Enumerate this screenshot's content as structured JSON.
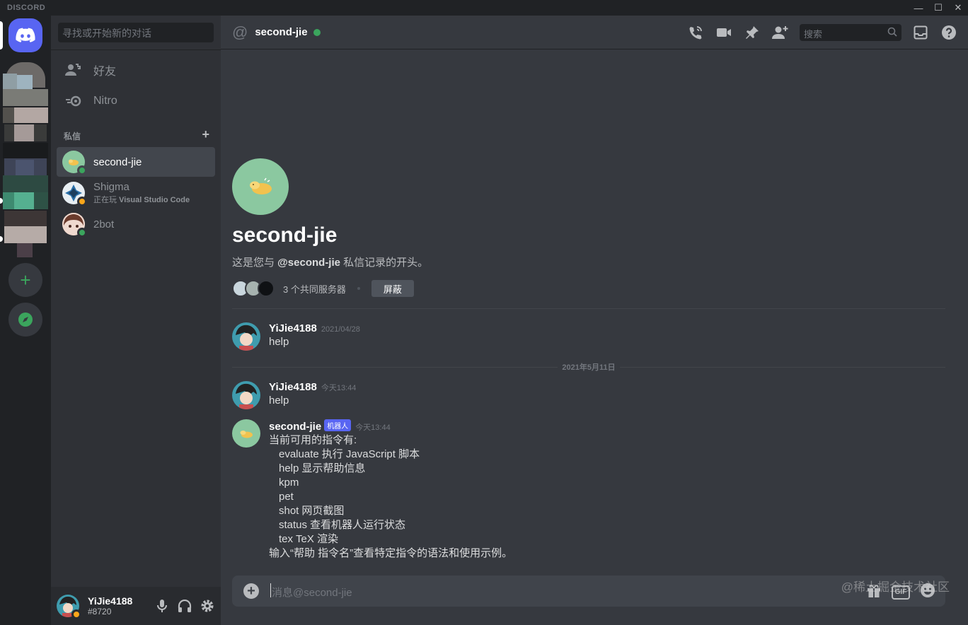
{
  "window": {
    "brand": "DISCORD"
  },
  "sidebar": {
    "search_placeholder": "寻找或开始新的对话",
    "nav": [
      {
        "label": "好友",
        "icon": "friends-icon"
      },
      {
        "label": "Nitro",
        "icon": "nitro-icon"
      }
    ],
    "dm_header": "私信",
    "dms": [
      {
        "name": "second-jie",
        "status": "online",
        "active": true
      },
      {
        "name": "Shigma",
        "activity_prefix": "正在玩",
        "activity_game": "Visual Studio Code",
        "status": "idle"
      },
      {
        "name": "2bot",
        "status": "online"
      }
    ]
  },
  "user": {
    "name": "YiJie4188",
    "tag": "#8720"
  },
  "header": {
    "title": "second-jie",
    "search_placeholder": "搜索"
  },
  "intro": {
    "title": "second-jie",
    "desc_prefix": "这是您与 ",
    "desc_mention": "@second-jie",
    "desc_suffix": " 私信记录的开头。",
    "mutual_servers": "3 个共同服务器",
    "block_label": "屏蔽"
  },
  "date_divider": "2021年5月11日",
  "messages": [
    {
      "author": "YiJie4188",
      "time": "2021/04/28",
      "text": "help"
    },
    {
      "author": "YiJie4188",
      "time": "今天13:44",
      "text": "help"
    },
    {
      "author": "second-jie",
      "bot_tag": "机器人",
      "time": "今天13:44",
      "intro_line": "当前可用的指令有:",
      "commands": [
        {
          "name": "evaluate",
          "desc": "执行 JavaScript 脚本"
        },
        {
          "name": "help",
          "desc": "显示帮助信息"
        },
        {
          "name": "kpm",
          "desc": ""
        },
        {
          "name": "pet",
          "desc": ""
        },
        {
          "name": "shot",
          "desc": "网页截图"
        },
        {
          "name": "status",
          "desc": "查看机器人运行状态"
        },
        {
          "name": "tex",
          "desc": "TeX 渲染"
        }
      ],
      "outro_line": "输入“帮助 指令名”查看特定指令的语法和使用示例。"
    }
  ],
  "composer": {
    "placeholder": "消息@second-jie",
    "gif_label": "GIF"
  },
  "watermark": "@稀土掘金技术社区",
  "colors": {
    "accent": "#5865f2",
    "online": "#3ba55d",
    "idle": "#faa61a",
    "bot_avatar_bg": "#8bc8a0"
  }
}
